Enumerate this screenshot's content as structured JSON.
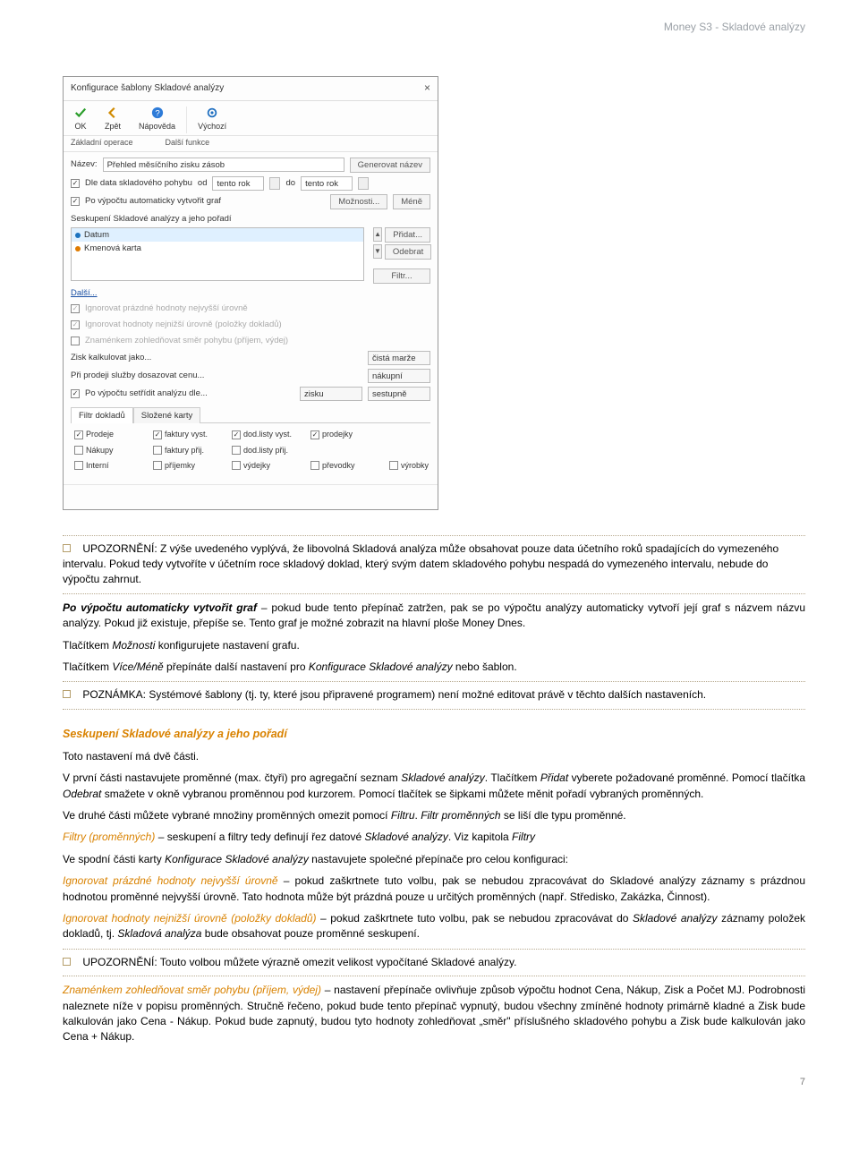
{
  "header": {
    "title": "Money S3 - Skladové analýzy"
  },
  "dialog": {
    "title": "Konfigurace šablony Skladové analýzy",
    "toolbar": {
      "ok": "OK",
      "back": "Zpět",
      "help": "Nápověda",
      "default": "Výchozí"
    },
    "ribbonGroups": {
      "basic": "Základní operace",
      "more": "Další funkce"
    },
    "nameLabel": "Název:",
    "nameValue": "Přehled měsíčního zisku zásob",
    "genName": "Generovat název",
    "byDateLabel": "Dle data skladového pohybu",
    "from": "od",
    "to": "do",
    "fromValue": "tento rok",
    "toValue": "tento rok",
    "autoGraphLabel": "Po výpočtu automaticky vytvořit graf",
    "optionsBtn": "Možnosti...",
    "lessBtn": "Méně",
    "groupingLabel": "Seskupení Skladové analýzy a jeho pořadí",
    "listItems": {
      "datum": "Datum",
      "kmen": "Kmenová karta"
    },
    "addBtn": "Přidat...",
    "removeBtn": "Odebrat",
    "filterBtn": "Filtr...",
    "moreLink": "Další...",
    "ignoreTop": "Ignorovat prázdné hodnoty nejvyšší úrovně",
    "ignoreBottom": "Ignorovat hodnoty nejnižší úrovně (položky dokladů)",
    "sign": "Znaménkem zohledňovat směr pohybu (příjem, výdej)",
    "ziskLabel": "Zisk kalkulovat jako...",
    "ziskValue": "čistá marže",
    "prodejLabel": "Při prodeji služby dosazovat cenu...",
    "prodejValue": "nákupní",
    "sortLabel": "Po výpočtu setřídit analýzu dle...",
    "sortField": "zisku",
    "sortDir": "sestupně",
    "tabFiltr": "Filtr dokladů",
    "tabSklady": "Složené karty",
    "filters": {
      "r1c1": "Prodeje",
      "r1c2": "faktury vyst.",
      "r1c3": "dod.listy vyst.",
      "r1c4": "prodejky",
      "r2c1": "Nákupy",
      "r2c2": "faktury přij.",
      "r2c3": "dod.listy přij.",
      "r3c1": "Interní",
      "r3c2": "příjemky",
      "r3c3": "výdejky",
      "r3c4": "převodky",
      "r3c5": "výrobky"
    }
  },
  "body": {
    "warn1": "UPOZORNĚNÍ: Z výše uvedeného vyplývá, že libovolná Skladová analýza může obsahovat pouze data účetního roků spadajících do vymezeného intervalu. Pokud tedy vytvoříte v účetním roce skladový doklad, který svým datem skladového pohybu nespadá do vymezeného intervalu, nebude do výpočtu zahrnut.",
    "p_autoGraph_lead": "Po výpočtu automaticky vytvořit graf",
    "p_autoGraph_rest": " – pokud bude tento přepínač zatržen, pak se po výpočtu analýzy automaticky vytvoří její graf s názvem názvu analýzy. Pokud již existuje, přepíše se. Tento graf je možné zobrazit na hlavní ploše Money Dnes.",
    "p_options_a": "Tlačítkem ",
    "p_options_i": "Možnosti",
    "p_options_b": " konfigurujete nastavení grafu.",
    "p_more_a": "Tlačítkem ",
    "p_more_i": "Více/Méně",
    "p_more_b": " přepínáte další nastavení pro ",
    "p_more_i2": "Konfigurace Skladové analýzy",
    "p_more_c": " nebo šablon.",
    "note1": "POZNÁMKA: Systémové šablony (tj. ty, které jsou připravené programem) není možné editovat právě v těchto dalších nastaveních.",
    "h_group": "Seskupení Skladové analýzy a jeho pořadí",
    "p_two": "Toto nastavení má dvě části.",
    "p_first_a": "V první části nastavujete proměnné (max. čtyři) pro agregační seznam ",
    "p_first_i1": "Skladové analýzy",
    "p_first_b": ". Tlačítkem ",
    "p_first_i2": "Přidat",
    "p_first_c": " vyberete požadované proměnné. Pomocí tlačítka ",
    "p_first_i3": "Odebrat",
    "p_first_d": " smažete v okně vybranou proměnnou pod kurzorem. Pomocí tlačítek se šipkami můžete měnit pořadí vybraných proměnných.",
    "p_second_a": "Ve druhé části můžete vybrané množiny proměnných omezit pomocí ",
    "p_second_i1": "Filtru",
    "p_second_b": ". ",
    "p_second_i2": "Filtr proměnných",
    "p_second_c": " se liší dle typu proměnné.",
    "p_filters_lead": "Filtry (proměnných)",
    "p_filters_a": " – seskupení a filtry tedy definují řez datové ",
    "p_filters_i1": "Skladové analýzy",
    "p_filters_b": ". Viz kapitola ",
    "p_filters_i2": "Filtry",
    "p_bottom_a": "Ve spodní části karty ",
    "p_bottom_i1": "Konfigurace Skladové analýzy",
    "p_bottom_b": " nastavujete společné přepínače pro celou konfiguraci:",
    "p_ignTop_lead": "Ignorovat prázdné hodnoty nejvyšší úrovně",
    "p_ignTop_rest": " – pokud zaškrtnete tuto volbu, pak se nebudou zpracovávat do Skladové analýzy záznamy s prázdnou hodnotou proměnné nejvyšší úrovně. Tato hodnota může být prázdná pouze u určitých proměnných (např. Středisko, Zakázka, Činnost).",
    "p_ignBot_lead": "Ignorovat hodnoty nejnižší úrovně (položky dokladů)",
    "p_ignBot_a": " – pokud zaškrtnete tuto volbu, pak se nebudou zpracovávat do ",
    "p_ignBot_i1": "Skladové analýzy",
    "p_ignBot_b": " záznamy položek dokladů, tj. ",
    "p_ignBot_i2": "Skladová analýza",
    "p_ignBot_c": " bude obsahovat pouze proměnné seskupení.",
    "warn2": "UPOZORNĚNÍ: Touto volbou můžete výrazně omezit velikost vypočítané Skladové analýzy.",
    "p_sign_lead": "Znaménkem zohledňovat směr pohybu (příjem, výdej)",
    "p_sign_rest": " – nastavení přepínače ovlivňuje způsob výpočtu hodnot Cena, Nákup, Zisk a Počet MJ. Podrobnosti naleznete níže v popisu proměnných. Stručně řečeno, pokud bude tento přepínač vypnutý, budou všechny zmíněné hodnoty primárně kladné a Zisk bude kalkulován jako Cena - Nákup. Pokud bude zapnutý, budou tyto hodnoty  zohledňovat „směr\"  příslušného skladového  pohybu a Zisk bude kalkulován jako Cena + Nákup."
  },
  "pageNumber": "7"
}
